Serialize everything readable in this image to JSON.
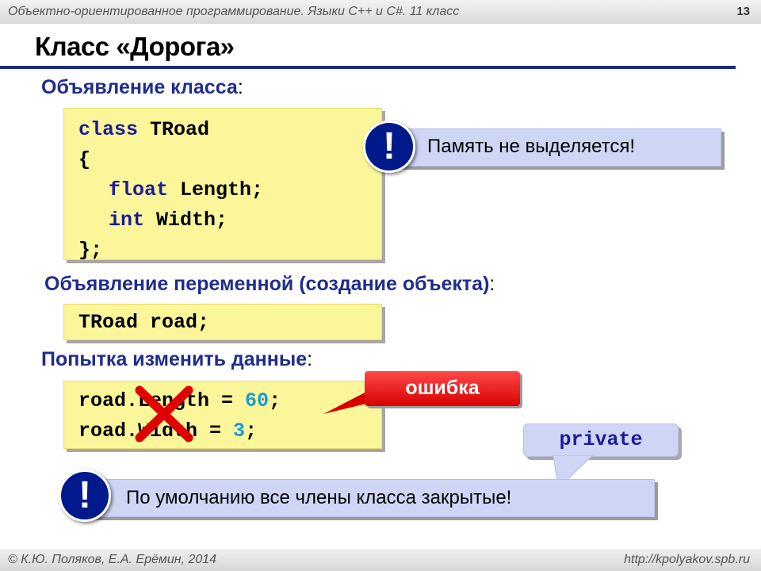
{
  "header": {
    "course": "Объектно-ориентированное программирование. Языки C++ и C#. 11 класс",
    "slide_number": "13"
  },
  "title": "Класс «Дорога»",
  "section1": {
    "heading": "Объявление класса",
    "colon": ":",
    "code": {
      "kw_class": "class",
      "classname": " TRoad",
      "open_brace": "{",
      "kw_float": "float",
      "field1": " Length;",
      "kw_int": "int",
      "field2": " Width;",
      "close_brace": "};"
    },
    "note_symbol": "!",
    "note_text": "Память не выделяется!"
  },
  "section2": {
    "heading": "Объявление переменной (создание объекта)",
    "colon": ":",
    "code_line": "TRoad road;"
  },
  "section3": {
    "heading": "Попытка изменить данные",
    "colon": ":",
    "line1_var": "road.Length",
    "line1_op": " = ",
    "line1_value": "60",
    "line1_end": ";",
    "line2_var": "road.Width",
    "line2_op": " = ",
    "line2_value": "3",
    "line2_end": ";",
    "error_label": "ошибка"
  },
  "callout": {
    "keyword": "private",
    "symbol": "!",
    "text": "По умолчанию все члены класса закрытые!"
  },
  "footer": {
    "authors": "© К.Ю. Поляков, Е.А. Ерёмин, 2014",
    "url": "http://kpolyakov.spb.ru"
  },
  "colors": {
    "heading": "#1f2d8c",
    "code_background": "#fbf69a",
    "note_background": "#cfd5f5",
    "error": "#e00000",
    "numeric_literal": "#1a9ad6"
  }
}
